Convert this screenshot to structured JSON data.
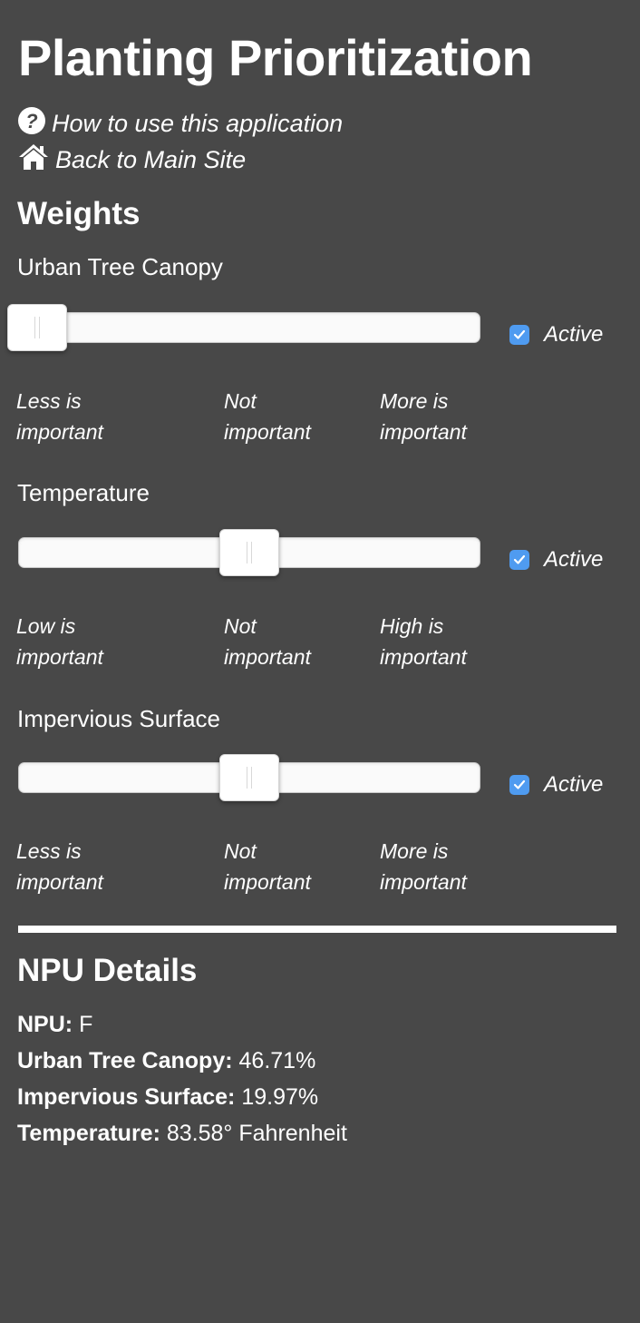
{
  "header": {
    "title": "Planting Prioritization",
    "help_link": "How to use this application",
    "home_link": "Back to Main Site"
  },
  "weights": {
    "heading": "Weights",
    "active_label": "Active",
    "factors": [
      {
        "label": "Urban Tree Canopy",
        "value": 0.0,
        "active": true,
        "scale_left": [
          "Less is",
          "important"
        ],
        "scale_mid": [
          "Not",
          "important"
        ],
        "scale_right": [
          "More is",
          "important"
        ]
      },
      {
        "label": "Temperature",
        "value": 0.5,
        "active": true,
        "scale_left": [
          "Low is",
          "important"
        ],
        "scale_mid": [
          "Not",
          "important"
        ],
        "scale_right": [
          "High is",
          "important"
        ]
      },
      {
        "label": "Impervious Surface",
        "value": 0.5,
        "active": true,
        "scale_left": [
          "Less is",
          "important"
        ],
        "scale_mid": [
          "Not",
          "important"
        ],
        "scale_right": [
          "More is",
          "important"
        ]
      }
    ]
  },
  "npu_details": {
    "heading": "NPU Details",
    "rows": [
      {
        "label": "NPU:",
        "value": "F"
      },
      {
        "label": "Urban Tree Canopy:",
        "value": "46.71%"
      },
      {
        "label": "Impervious Surface:",
        "value": "19.97%"
      },
      {
        "label": "Temperature:",
        "value": "83.58° Fahrenheit"
      }
    ]
  },
  "icons": {
    "help": "question-circle-icon",
    "home": "home-icon",
    "checkbox": "checkmark-icon"
  },
  "colors": {
    "background": "#484848",
    "checkbox": "#4f9bf0",
    "text": "#ffffff"
  }
}
